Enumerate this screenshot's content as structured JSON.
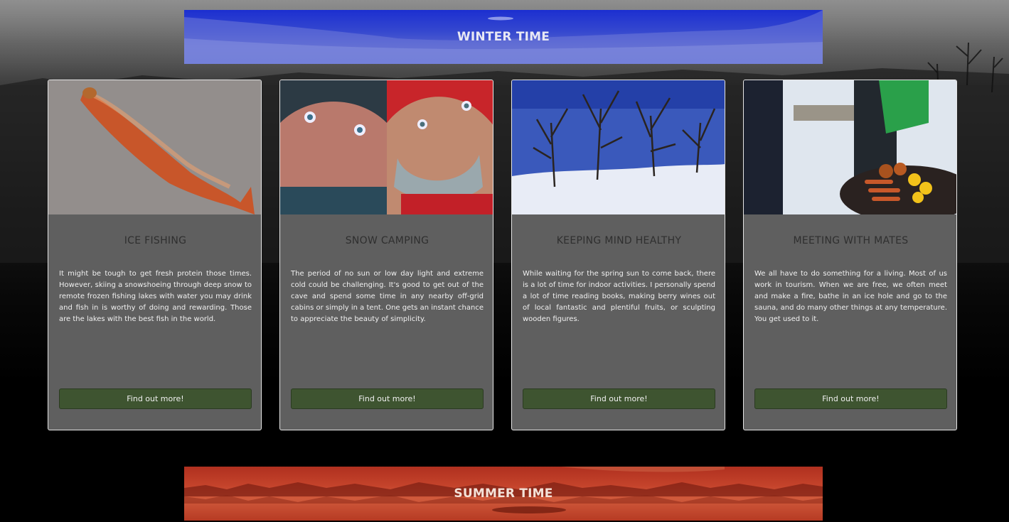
{
  "winter_banner": {
    "title": "WINTER TIME"
  },
  "summer_banner": {
    "title": "SUMMER TIME"
  },
  "cards": [
    {
      "title": "ICE FISHING",
      "text": "It might be tough to get fresh protein those times. However, skiing a snowshoeing through deep snow to remote frozen fishing lakes with water you may drink and fish in is worthy of doing and rewarding. Those are the lakes with the best fish in the world.",
      "button": "Find out more!"
    },
    {
      "title": "SNOW CAMPING",
      "text": "The period of no sun or low day light and extreme cold could be challenging. It's good to get out of the cave and spend some time in any nearby off-grid cabins or simply in a tent. One gets an instant chance to appreciate the beauty of simplicity.",
      "button": "Find out more!"
    },
    {
      "title": "KEEPING MIND HEALTHY",
      "text": "While waiting for the spring sun to come back, there is a lot of time for indoor activities. I personally spend a lot of time reading books, making berry wines out of local fantastic and plentiful fruits, or sculpting wooden figures.",
      "button": "Find out more!"
    },
    {
      "title": "MEETING WITH MATES",
      "text": "We all have to do something for a living. Most of us work in tourism. When we are free, we often meet and make a fire, bathe in an ice hole and go to the sauna, and do many other things at any temperature. You get used to it.",
      "button": "Find out more!"
    }
  ]
}
